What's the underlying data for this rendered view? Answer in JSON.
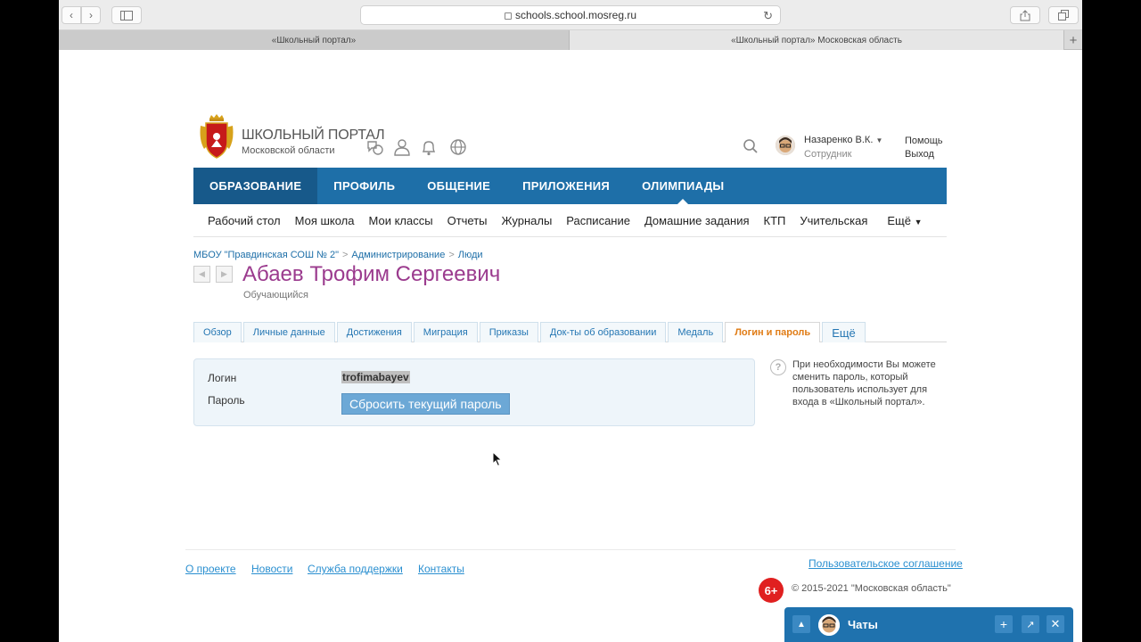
{
  "browser": {
    "url": "schools.school.mosreg.ru",
    "tabs": [
      "«Школьный портал»",
      "«Школьный портал» Московская область"
    ]
  },
  "header": {
    "brand_title": "ШКОЛЬНЫЙ ПОРТАЛ",
    "brand_sub": "Московской области",
    "user_name": "Назаренко В.К.",
    "user_role": "Сотрудник",
    "help": "Помощь",
    "logout": "Выход"
  },
  "mainnav": [
    "ОБРАЗОВАНИЕ",
    "ПРОФИЛЬ",
    "ОБЩЕНИЕ",
    "ПРИЛОЖЕНИЯ",
    "ОЛИМПИАДЫ"
  ],
  "subnav": [
    "Рабочий стол",
    "Моя школа",
    "Мои классы",
    "Отчеты",
    "Журналы",
    "Расписание",
    "Домашние задания",
    "КТП",
    "Учительская"
  ],
  "subnav_more": "Ещё",
  "breadcrumb": [
    "МБОУ \"Правдинская СОШ № 2\"",
    "Администрирование",
    "Люди"
  ],
  "person": {
    "name": "Абаев Трофим Сергеевич",
    "role": "Обучающийся"
  },
  "profile_tabs": [
    "Обзор",
    "Личные данные",
    "Достижения",
    "Миграция",
    "Приказы",
    "Док-ты об образовании",
    "Медаль",
    "Логин и пароль",
    "Ещё"
  ],
  "form": {
    "login_label": "Логин",
    "login_value": "trofimabayev",
    "password_label": "Пароль",
    "reset_button": "Сбросить текущий пароль"
  },
  "help_text": "При необходимости Вы можете сменить пароль, который пользователь использует для входа в «Школьный портал».",
  "footer": {
    "links": [
      "О проекте",
      "Новости",
      "Служба поддержки",
      "Контакты"
    ],
    "agreement": "Пользовательское соглашение",
    "age": "6+",
    "copyright": "© 2015-2021 \"Московская область\""
  },
  "chat": {
    "title": "Чаты"
  },
  "colors": {
    "nav": "#1e6fa8",
    "name": "#9b3b8e",
    "active_tab": "#e07c16"
  }
}
